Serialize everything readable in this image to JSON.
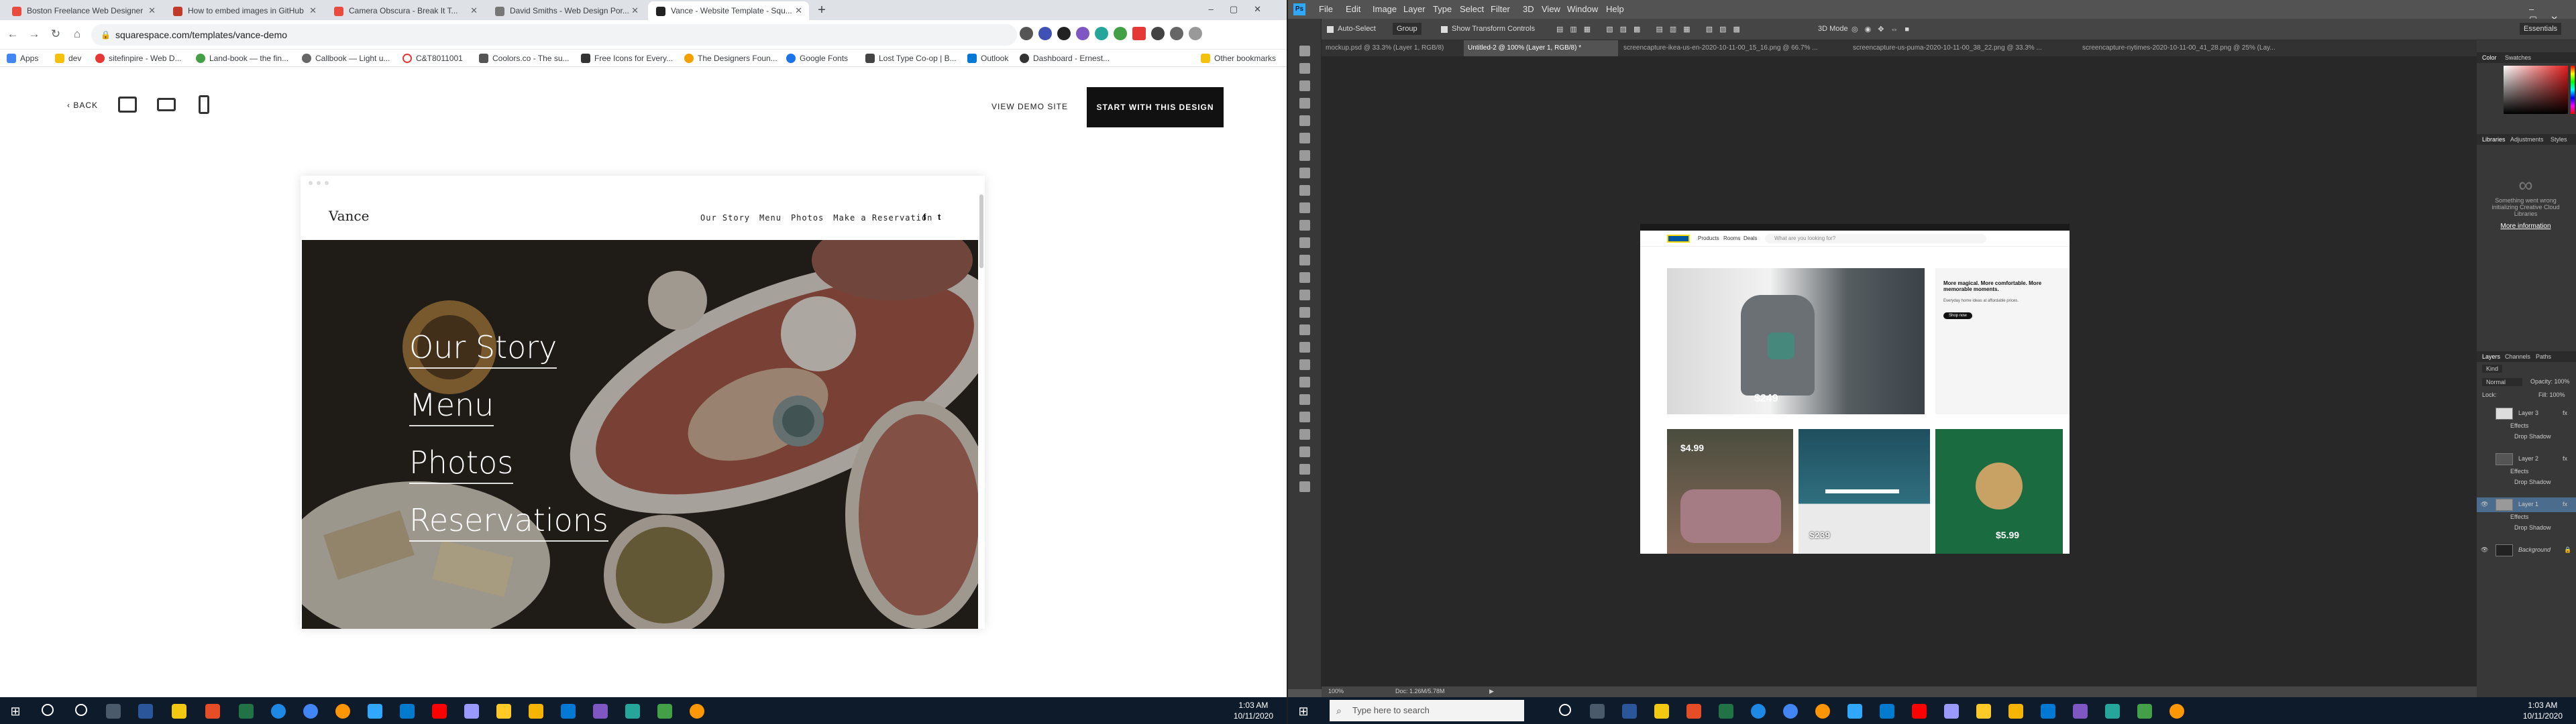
{
  "left": {
    "tabs": [
      {
        "label": "Boston Freelance Web Designer",
        "color": "#e74c3c"
      },
      {
        "label": "How to embed images in GitHub",
        "color": "#c0392b"
      },
      {
        "label": "Camera Obscura - Break It T...",
        "color": "#e74c3c"
      },
      {
        "label": "David Smiths - Web Design Por...",
        "color": "#777777"
      },
      {
        "label": "Vance - Website Template - Squ...",
        "color": "#222222"
      }
    ],
    "url": "squarespace.com/templates/vance-demo",
    "bookmarks": [
      {
        "label": "Apps",
        "color": "#4285f4"
      },
      {
        "label": "dev",
        "color": "#f4c20d"
      },
      {
        "label": "sitefinpire - Web D...",
        "color": "#e53935"
      },
      {
        "label": "Land-book — the fin...",
        "color": "#43a047"
      },
      {
        "label": "Callbook — Light u...",
        "color": "#666666"
      },
      {
        "label": "C&T8011001",
        "color": "#e53935"
      },
      {
        "label": "Coolors.co - The su...",
        "color": "#555555"
      },
      {
        "label": "Free Icons for Every...",
        "color": "#333333"
      },
      {
        "label": "The Designers Foun...",
        "color": "#f4a000"
      },
      {
        "label": "Google Fonts",
        "color": "#1a73e8"
      },
      {
        "label": "Lost Type Co-op | B...",
        "color": "#444444"
      },
      {
        "label": "Outlook",
        "color": "#0078d4"
      },
      {
        "label": "Dashboard - Ernest...",
        "color": "#333333"
      },
      {
        "label": "Other bookmarks",
        "color": "#f4c20d"
      }
    ],
    "back_label": "BACK",
    "view_demo": "VIEW DEMO SITE",
    "start_btn": "START WITH THIS DESIGN",
    "site": {
      "logo": "Vance",
      "nav": [
        "Our Story",
        "Menu",
        "Photos",
        "Make a Reservation"
      ],
      "hero_menu": [
        "Our Story",
        "Menu",
        "Photos",
        "Reservations"
      ]
    },
    "clock": {
      "time": "1:03 AM",
      "date": "10/11/2020"
    }
  },
  "right": {
    "menu": [
      "File",
      "Edit",
      "Image",
      "Layer",
      "Type",
      "Select",
      "Filter",
      "3D",
      "View",
      "Window",
      "Help"
    ],
    "options": {
      "auto_select": "Auto-Select",
      "group": "Group",
      "show_transform": "Show Transform Controls",
      "mode3d": "3D Mode",
      "workspace": "Essentials"
    },
    "doc_tabs": [
      "mockup.psd @ 33.3% (Layer 1, RGB/8)",
      "Untitled-2 @ 100% (Layer 1, RGB/8) *",
      "screencapture-ikea-us-en-2020-10-11-00_15_16.png @ 66.7% ...",
      "screencapture-us-puma-2020-10-11-00_38_22.png @ 33.3% ...",
      "screencapture-nytimes-2020-10-11-00_41_28.png @ 25% (Lay..."
    ],
    "ikea": {
      "nav": [
        "Products",
        "Rooms",
        "Deals"
      ],
      "search": "What are you looking for?",
      "headline": "More magical. More comfortable. More memorable moments.",
      "sub": "Everyday home ideas at affordable prices.",
      "cta": "Shop now",
      "prices": [
        "$249",
        "$4.99",
        "$239",
        "$5.99"
      ]
    },
    "status": {
      "zoom": "100%",
      "doc": "Doc: 1.26M/5.78M"
    },
    "panels": {
      "color_tabs": [
        "Color",
        "Swatches"
      ],
      "lib_tabs": [
        "Libraries",
        "Adjustments",
        "Styles"
      ],
      "lib_msg": "Something went wrong initializing Creative Cloud Libraries",
      "lib_link": "More information",
      "layer_tabs": [
        "Layers",
        "Channels",
        "Paths"
      ],
      "kind": "Kind",
      "blend": "Normal",
      "opacity": "Opacity: 100%",
      "lock": "Lock:",
      "fill": "Fill: 100%",
      "layers": [
        {
          "name": "Layer 3",
          "fx": "fx"
        },
        {
          "name": "Effects"
        },
        {
          "name": "Drop Shadow"
        },
        {
          "name": "Layer 2",
          "fx": "fx"
        },
        {
          "name": "Effects"
        },
        {
          "name": "Drop Shadow"
        },
        {
          "name": "Layer 1",
          "fx": "fx"
        },
        {
          "name": "Effects"
        },
        {
          "name": "Drop Shadow"
        },
        {
          "name": "Background"
        }
      ]
    },
    "search_placeholder": "Type here to search",
    "clock": {
      "time": "1:03 AM",
      "date": "10/11/2020"
    }
  }
}
